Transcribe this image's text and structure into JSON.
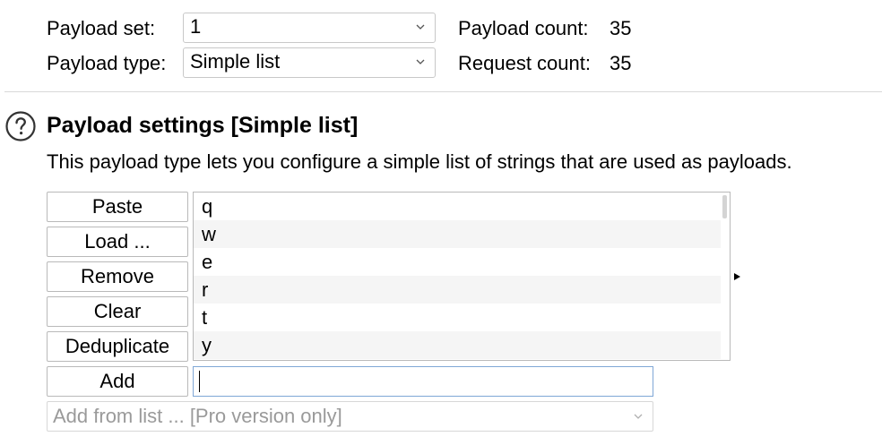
{
  "payload_set": {
    "label": "Payload set:",
    "value": "1",
    "count_label": "Payload count:",
    "count_value": "35"
  },
  "payload_type": {
    "label": "Payload type:",
    "value": "Simple list",
    "request_label": "Request count:",
    "request_value": "35"
  },
  "settings": {
    "title": "Payload settings [Simple list]",
    "description": "This payload type lets you configure a simple list of strings that are used as payloads."
  },
  "buttons": {
    "paste": "Paste",
    "load": "Load ...",
    "remove": "Remove",
    "clear": "Clear",
    "deduplicate": "Deduplicate",
    "add": "Add"
  },
  "list_items": [
    "q",
    "w",
    "e",
    "r",
    "t",
    "y"
  ],
  "add_input": {
    "value": ""
  },
  "add_from_list": {
    "label": "Add from list ... [Pro version only]"
  },
  "icons": {
    "help": "help-circle-icon",
    "dropdown": "chevron-down-icon",
    "expand": "triangle-right-icon"
  },
  "colors": {
    "divider": "#d9d9d9",
    "list_alt_row": "#f5f5f5",
    "focus_border": "#7fa7d6",
    "disabled_text": "#9a9a9a"
  }
}
